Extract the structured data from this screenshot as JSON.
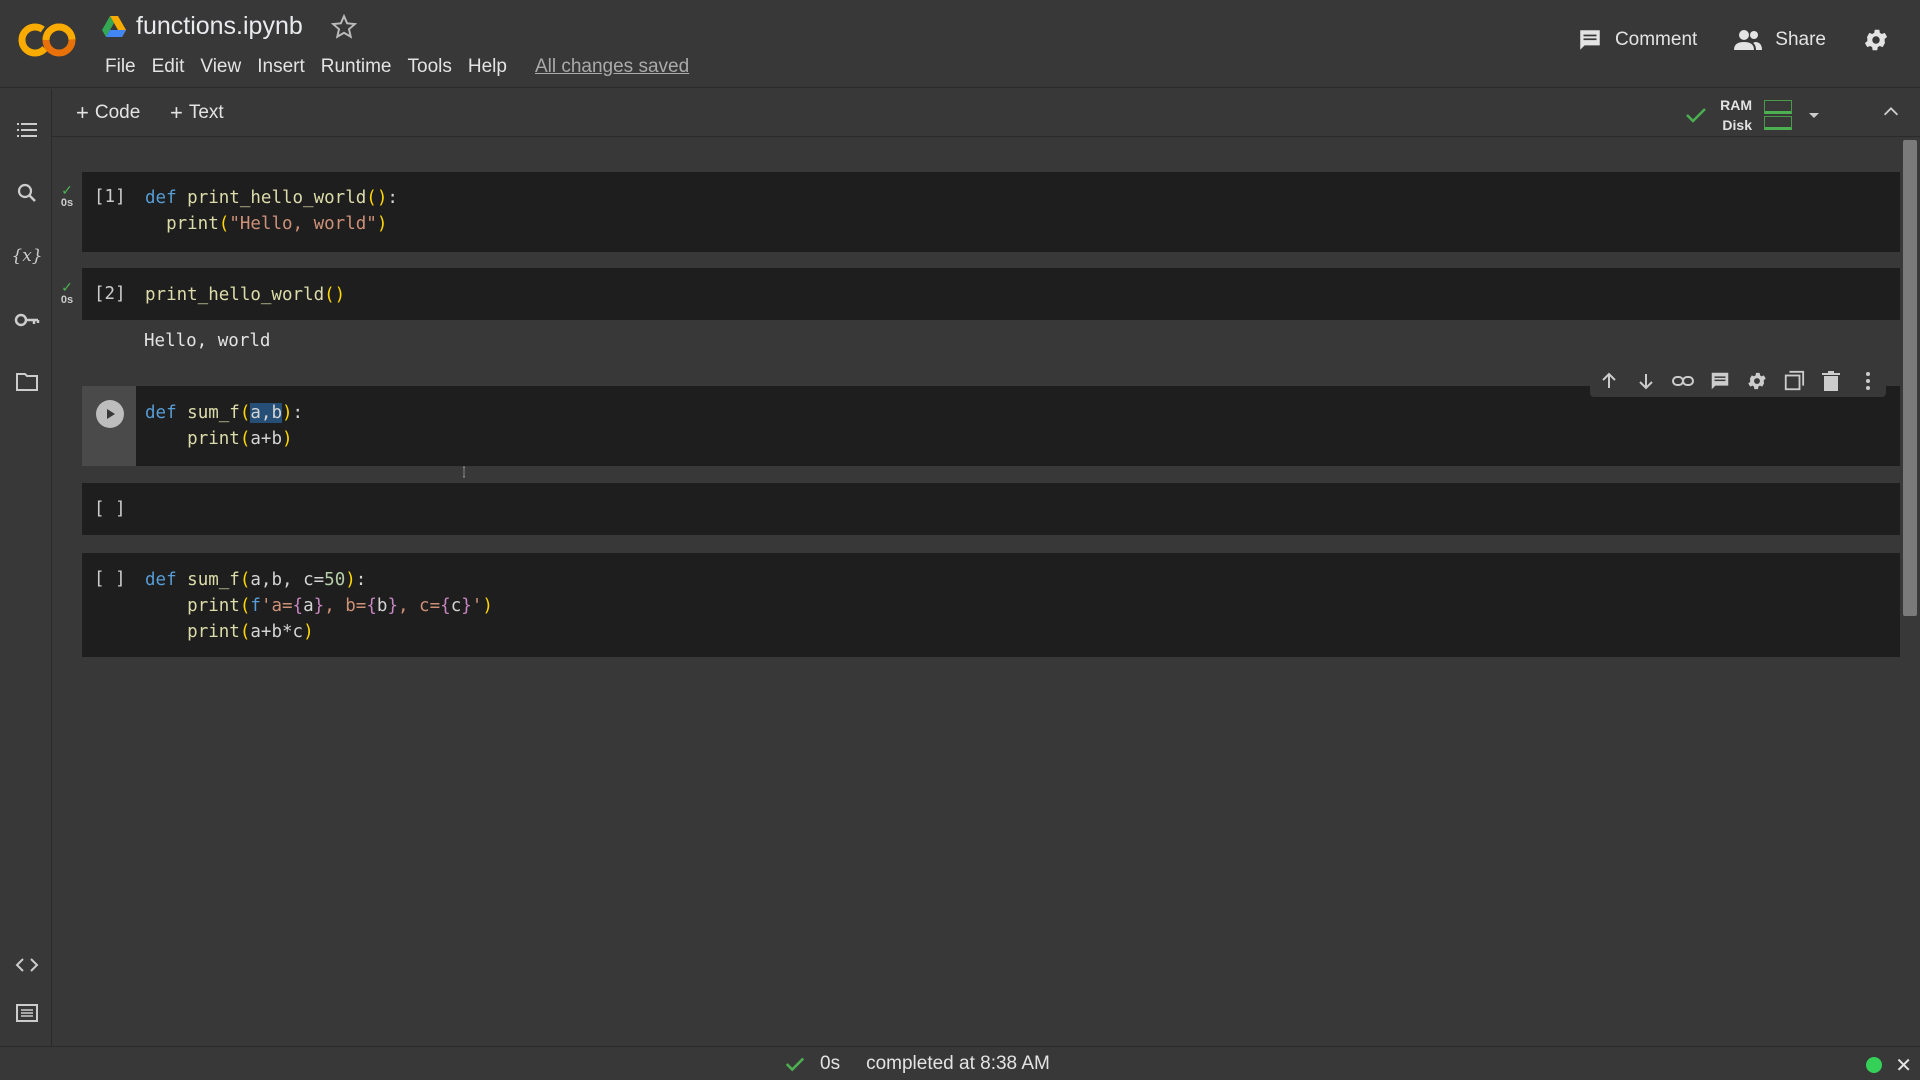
{
  "header": {
    "file_title": "functions.ipynb",
    "menu": [
      "File",
      "Edit",
      "View",
      "Insert",
      "Runtime",
      "Tools",
      "Help"
    ],
    "saved_status": "All changes saved",
    "comment_label": "Comment",
    "share_label": "Share"
  },
  "toolbar": {
    "add_code": "Code",
    "add_text": "Text",
    "ram_label": "RAM",
    "disk_label": "Disk"
  },
  "cells": [
    {
      "exec_count": "[1]",
      "run_time": "0s",
      "lines": [
        "def print_hello_world():",
        "  print(\"Hello, world\")"
      ]
    },
    {
      "exec_count": "[2]",
      "run_time": "0s",
      "lines": [
        "print_hello_world()"
      ],
      "output": "Hello, world"
    },
    {
      "exec_count": "",
      "lines": [
        "def sum_f(a,b):",
        "    print(a+b)"
      ],
      "selected_text": "a,b"
    },
    {
      "exec_count": "[ ]",
      "lines": [
        ""
      ]
    },
    {
      "exec_count": "[ ]",
      "lines": [
        "def sum_f(a,b, c=50):",
        "    print(f'a={a}, b={b}, c={c}')",
        "    print(a+b*c)"
      ]
    }
  ],
  "statusbar": {
    "duration": "0s",
    "message": "completed at 8:38 AM"
  },
  "colors": {
    "background": "#383838",
    "cell_background": "#1e1e1e",
    "keyword": "#569cd6",
    "success": "#4caf50",
    "logo_orange": "#f9ab00"
  }
}
